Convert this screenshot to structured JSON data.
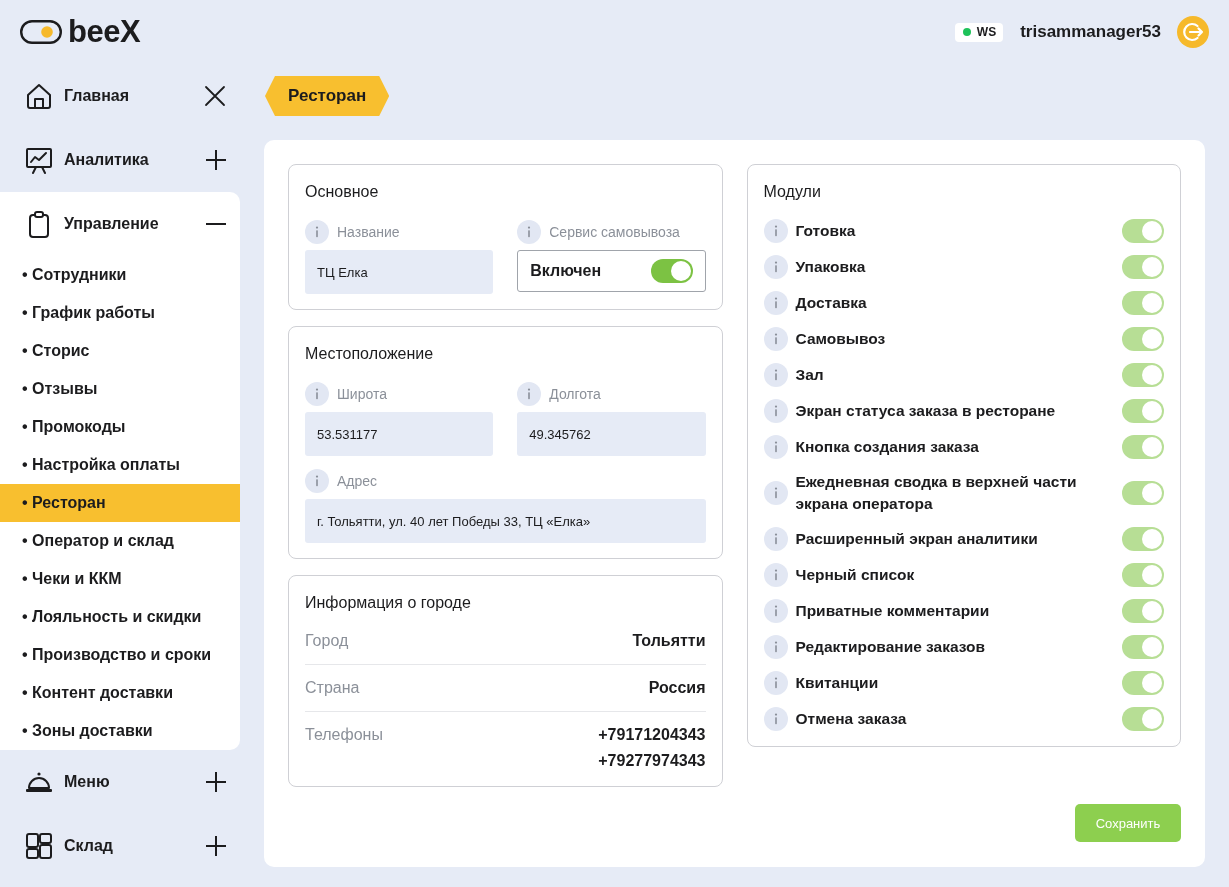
{
  "header": {
    "brand": "beeX",
    "ws": {
      "label": "WS",
      "connected": true
    },
    "username": "trisammanager53"
  },
  "sidebar": {
    "items": [
      {
        "label": "Главная",
        "kind": "close"
      },
      {
        "label": "Аналитика",
        "kind": "group",
        "expanded": false
      },
      {
        "label": "Управление",
        "kind": "group",
        "expanded": true,
        "children": [
          {
            "label": "• Сотрудники",
            "selected": false
          },
          {
            "label": "• График работы",
            "selected": false
          },
          {
            "label": "• Сторис",
            "selected": false
          },
          {
            "label": "• Отзывы",
            "selected": false
          },
          {
            "label": "• Промокоды",
            "selected": false
          },
          {
            "label": "• Настройка оплаты",
            "selected": false
          },
          {
            "label": "• Ресторан",
            "selected": true
          },
          {
            "label": "• Оператор и склад",
            "selected": false
          },
          {
            "label": "• Чеки и ККМ",
            "selected": false
          },
          {
            "label": "• Лояльность и скидки",
            "selected": false
          },
          {
            "label": "• Производство и сроки",
            "selected": false
          },
          {
            "label": "• Контент доставки",
            "selected": false
          },
          {
            "label": "• Зоны доставки",
            "selected": false
          }
        ]
      },
      {
        "label": "Меню",
        "kind": "group",
        "expanded": false
      },
      {
        "label": "Склад",
        "kind": "group",
        "expanded": false
      }
    ]
  },
  "breadcrumb": "Ресторан",
  "basic": {
    "title": "Основное",
    "name_field": {
      "label": "Название",
      "value": "ТЦ Елка"
    },
    "pickup": {
      "label": "Сервис самовывоза",
      "value": "Включен",
      "on": true
    }
  },
  "location": {
    "title": "Местоположение",
    "latitude": {
      "label": "Широта",
      "value": "53.531177"
    },
    "longitude": {
      "label": "Долгота",
      "value": "49.345762"
    },
    "address": {
      "label": "Адрес",
      "value": "г. Тольятти, ул. 40 лет Победы 33, ТЦ «Елка»"
    }
  },
  "city_info": {
    "title": "Информация о городе",
    "rows": [
      {
        "label": "Город",
        "values": [
          "Тольятти"
        ]
      },
      {
        "label": "Страна",
        "values": [
          "Россия"
        ]
      },
      {
        "label": "Телефоны",
        "values": [
          "+79171204343",
          "+79277974343"
        ]
      }
    ]
  },
  "modules": {
    "title": "Модули",
    "items": [
      {
        "label": "Готовка",
        "on": true,
        "disabled": true
      },
      {
        "label": "Упаковка",
        "on": true,
        "disabled": true
      },
      {
        "label": "Доставка",
        "on": true,
        "disabled": true
      },
      {
        "label": "Самовывоз",
        "on": true,
        "disabled": true
      },
      {
        "label": "Зал",
        "on": true,
        "disabled": true
      },
      {
        "label": "Экран статуса заказа в ресторане",
        "on": true,
        "disabled": true
      },
      {
        "label": "Кнопка создания заказа",
        "on": true,
        "disabled": true
      },
      {
        "label": "Ежедневная сводка в верхней части экрана оператора",
        "on": true,
        "disabled": true
      },
      {
        "label": "Расширенный экран аналитики",
        "on": true,
        "disabled": true
      },
      {
        "label": "Черный список",
        "on": true,
        "disabled": true
      },
      {
        "label": "Приватные комментарии",
        "on": true,
        "disabled": true
      },
      {
        "label": "Редактирование заказов",
        "on": true,
        "disabled": true
      },
      {
        "label": "Квитанции",
        "on": true,
        "disabled": true
      },
      {
        "label": "Отмена заказа",
        "on": true,
        "disabled": true
      }
    ]
  },
  "save_button": "Сохранить"
}
